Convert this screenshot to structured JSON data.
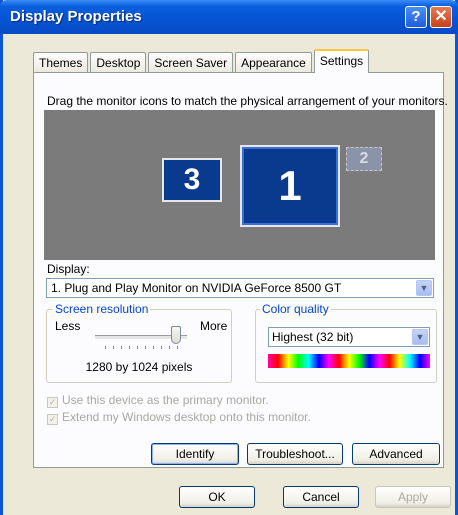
{
  "window": {
    "title": "Display Properties",
    "help_glyph": "?",
    "close_glyph": "✕"
  },
  "tabs": [
    {
      "label": "Themes"
    },
    {
      "label": "Desktop"
    },
    {
      "label": "Screen Saver"
    },
    {
      "label": "Appearance"
    },
    {
      "label": "Settings",
      "active": true
    }
  ],
  "settings": {
    "instruction": "Drag the monitor icons to match the physical arrangement of your monitors.",
    "monitors": [
      {
        "label": "3"
      },
      {
        "label": "1",
        "selected": true
      },
      {
        "label": "2",
        "inactive": true
      }
    ],
    "display_label": "Display:",
    "display_value": "1. Plug and Play Monitor on NVIDIA GeForce 8500 GT",
    "resolution": {
      "title": "Screen resolution",
      "less": "Less",
      "more": "More",
      "value": "1280 by 1024 pixels",
      "slider_level": 0.85
    },
    "color_quality": {
      "title": "Color quality",
      "value": "Highest (32 bit)"
    },
    "checkboxes": [
      {
        "label": "Use this device as the primary monitor.",
        "checked": true,
        "disabled": true
      },
      {
        "label": "Extend my Windows desktop onto this monitor.",
        "checked": true,
        "disabled": true
      }
    ],
    "buttons": {
      "identify": "Identify",
      "troubleshoot": "Troubleshoot...",
      "advanced": "Advanced"
    }
  },
  "footer": {
    "ok": "OK",
    "cancel": "Cancel",
    "apply": "Apply"
  },
  "colors": {
    "title_bar": "#0553d1",
    "monitor_blue": "#0a3a8e",
    "preview_bg": "#7b7b7b",
    "group_title": "#0046d5"
  }
}
